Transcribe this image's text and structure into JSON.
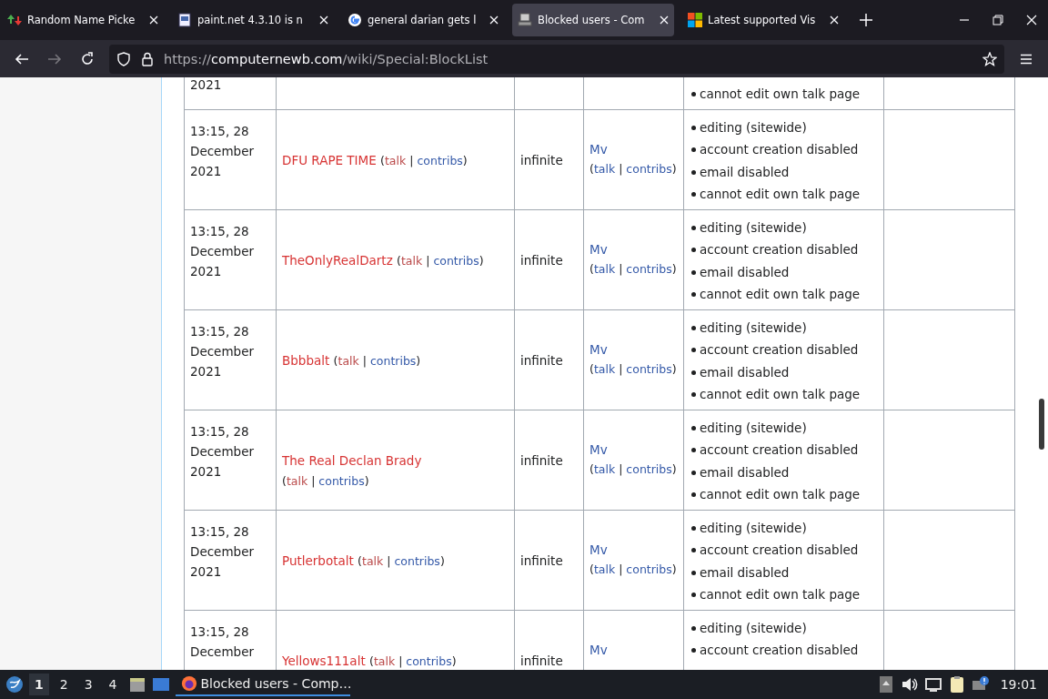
{
  "tabs": [
    {
      "title": "Random Name Picke",
      "selected": false
    },
    {
      "title": "paint.net 4.3.10 is n",
      "selected": false
    },
    {
      "title": "general darian gets l",
      "selected": false
    },
    {
      "title": "Blocked users - Com",
      "selected": true
    },
    {
      "title": "Latest supported Vis",
      "selected": false
    }
  ],
  "address": {
    "scheme": "https://",
    "domain": "computernewb.com",
    "path": "/wiki/Special:BlockList"
  },
  "top_row": {
    "timestamp": "2021",
    "restrictions": [
      "cannot edit own talk page"
    ]
  },
  "rows": [
    {
      "timestamp": "13:15, 28 December 2021",
      "target": {
        "name": "DFU RAPE TIME",
        "open": "(",
        "talk": "talk",
        "sep": "|",
        "contribs": "contribs",
        "close": ")",
        "name_missing": true,
        "talk_missing": true
      },
      "expiry": "infinite",
      "blocker": {
        "name": "Mv",
        "open": "(",
        "talk": "talk",
        "sep": "|",
        "contribs": "contribs",
        "close": ")"
      },
      "restrictions": [
        "editing (sitewide)",
        "account creation disabled",
        "email disabled",
        "cannot edit own talk page"
      ]
    },
    {
      "timestamp": "13:15, 28 December 2021",
      "target": {
        "name": "TheOnlyRealDartz",
        "open": "(",
        "talk": "talk",
        "sep": "|",
        "contribs": "contribs",
        "close": ")",
        "name_missing": true,
        "talk_missing": true
      },
      "expiry": "infinite",
      "blocker": {
        "name": "Mv",
        "open": "(",
        "talk": "talk",
        "sep": "|",
        "contribs": "contribs",
        "close": ")"
      },
      "restrictions": [
        "editing (sitewide)",
        "account creation disabled",
        "email disabled",
        "cannot edit own talk page"
      ]
    },
    {
      "timestamp": "13:15, 28 December 2021",
      "target": {
        "name": "Bbbbalt",
        "open": "(",
        "talk": "talk",
        "sep": "|",
        "contribs": "contribs",
        "close": ")",
        "name_missing": true,
        "talk_missing": true
      },
      "expiry": "infinite",
      "blocker": {
        "name": "Mv",
        "open": "(",
        "talk": "talk",
        "sep": "|",
        "contribs": "contribs",
        "close": ")"
      },
      "restrictions": [
        "editing (sitewide)",
        "account creation disabled",
        "email disabled",
        "cannot edit own talk page"
      ]
    },
    {
      "timestamp": "13:15, 28 December 2021",
      "target": {
        "name": "The Real Declan Brady",
        "open": "(",
        "talk": "talk",
        "sep": "|",
        "contribs": "contribs",
        "close": ")",
        "name_missing": true,
        "talk_missing": true
      },
      "expiry": "infinite",
      "blocker": {
        "name": "Mv",
        "open": "(",
        "talk": "talk",
        "sep": "|",
        "contribs": "contribs",
        "close": ")"
      },
      "restrictions": [
        "editing (sitewide)",
        "account creation disabled",
        "email disabled",
        "cannot edit own talk page"
      ]
    },
    {
      "timestamp": "13:15, 28 December 2021",
      "target": {
        "name": "Putlerbotalt",
        "open": "(",
        "talk": "talk",
        "sep": "|",
        "contribs": "contribs",
        "close": ")",
        "name_missing": true,
        "talk_missing": true
      },
      "expiry": "infinite",
      "blocker": {
        "name": "Mv",
        "open": "(",
        "talk": "talk",
        "sep": "|",
        "contribs": "contribs",
        "close": ")"
      },
      "restrictions": [
        "editing (sitewide)",
        "account creation disabled",
        "email disabled",
        "cannot edit own talk page"
      ]
    },
    {
      "timestamp": "13:15, 28 December",
      "target": {
        "name": "Yellows111alt",
        "open": "(",
        "talk": "talk",
        "sep": "|",
        "contribs": "contribs",
        "close": ")",
        "name_missing": true,
        "talk_missing": true
      },
      "expiry": "infinite",
      "blocker": {
        "name": "Mv"
      },
      "restrictions": [
        "editing (sitewide)",
        "account creation disabled"
      ]
    }
  ],
  "taskbar": {
    "workspaces": [
      {
        "label": "1",
        "selected": true
      },
      {
        "label": "2",
        "selected": false
      },
      {
        "label": "3",
        "selected": false
      },
      {
        "label": "4",
        "selected": false
      }
    ],
    "task": "Blocked users - Comp…",
    "clock": "19:01"
  }
}
